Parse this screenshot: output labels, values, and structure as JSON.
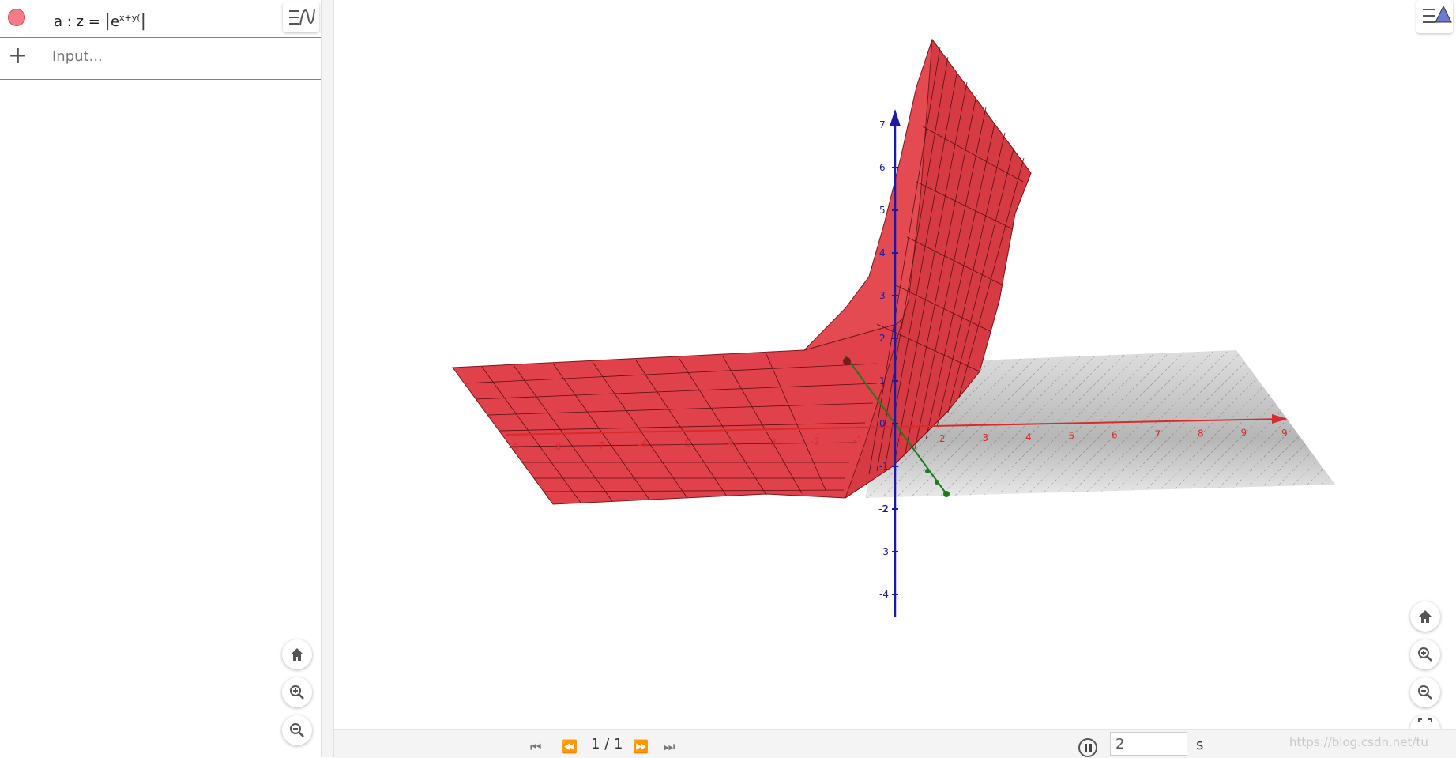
{
  "algebra": {
    "object_label": "a : z =",
    "formula_base": "e",
    "formula_exponent": "x+y(",
    "input_placeholder": "Input..."
  },
  "graphics": {
    "z_ticks": [
      "7",
      "6",
      "5",
      "4",
      "3",
      "2",
      "1",
      "0",
      "-1",
      "-2",
      "-3",
      "-4"
    ],
    "x_ticks": [
      "-9",
      "-8",
      "-7",
      "-6",
      "-5",
      "-4",
      "-3",
      "-2",
      "-1",
      "1",
      "2",
      "3",
      "4",
      "5",
      "6",
      "7",
      "8",
      "9"
    ],
    "x_axis_end_label": "9",
    "y_axis_neg_label": "-2"
  },
  "animation": {
    "page_indicator": "1 / 1",
    "speed_value": "2",
    "speed_unit": "s"
  },
  "watermark": "https://blog.csdn.net/tu",
  "colors": {
    "surface": "#e0414a",
    "x_axis": "#d92b2b",
    "z_axis": "#1a1aa6",
    "y_axis": "#1e7a1e",
    "plane": "#bdbdbd",
    "selection_line": "#7b78c9"
  }
}
